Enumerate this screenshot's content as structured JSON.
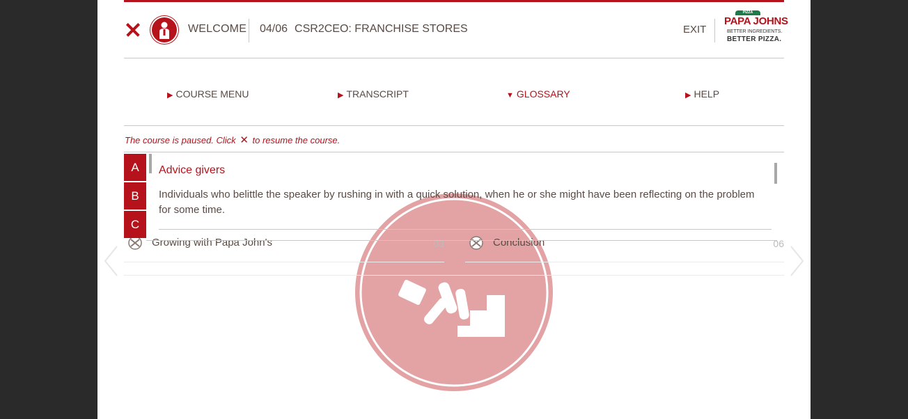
{
  "header": {
    "welcome": "WELCOME",
    "course_number": "04/06",
    "course_title": "CSR2CEO: FRANCHISE STORES",
    "exit": "EXIT",
    "logo": {
      "badge": "PIZZA",
      "brand": "PAPA JOHNS",
      "tagline1": "BETTER INGREDIENTS.",
      "tagline2": "BETTER PIZZA."
    }
  },
  "nav": {
    "items": [
      {
        "label": "COURSE MENU",
        "state": "collapsed"
      },
      {
        "label": "TRANSCRIPT",
        "state": "collapsed"
      },
      {
        "label": "GLOSSARY",
        "state": "expanded"
      },
      {
        "label": "HELP",
        "state": "collapsed"
      }
    ]
  },
  "notice": {
    "before": "The course is paused. Click",
    "icon": "close-icon",
    "after": "to resume the course."
  },
  "glossary": {
    "letters": [
      "A",
      "B",
      "C"
    ],
    "term": "Advice givers",
    "definition": "Individuals who belittle the speaker by rushing in with a quick solution, when he or she might have been reflecting on the problem for some time."
  },
  "course_menu": {
    "rows": [
      {
        "label": "Growing with Papa John's",
        "number": "03"
      },
      {
        "label": "Conclusion",
        "number": "06"
      }
    ]
  },
  "colors": {
    "accent": "#b5121b",
    "text": "#5a4a44",
    "hero": "#e3a3a5",
    "backdrop": "#2a2a2a"
  }
}
